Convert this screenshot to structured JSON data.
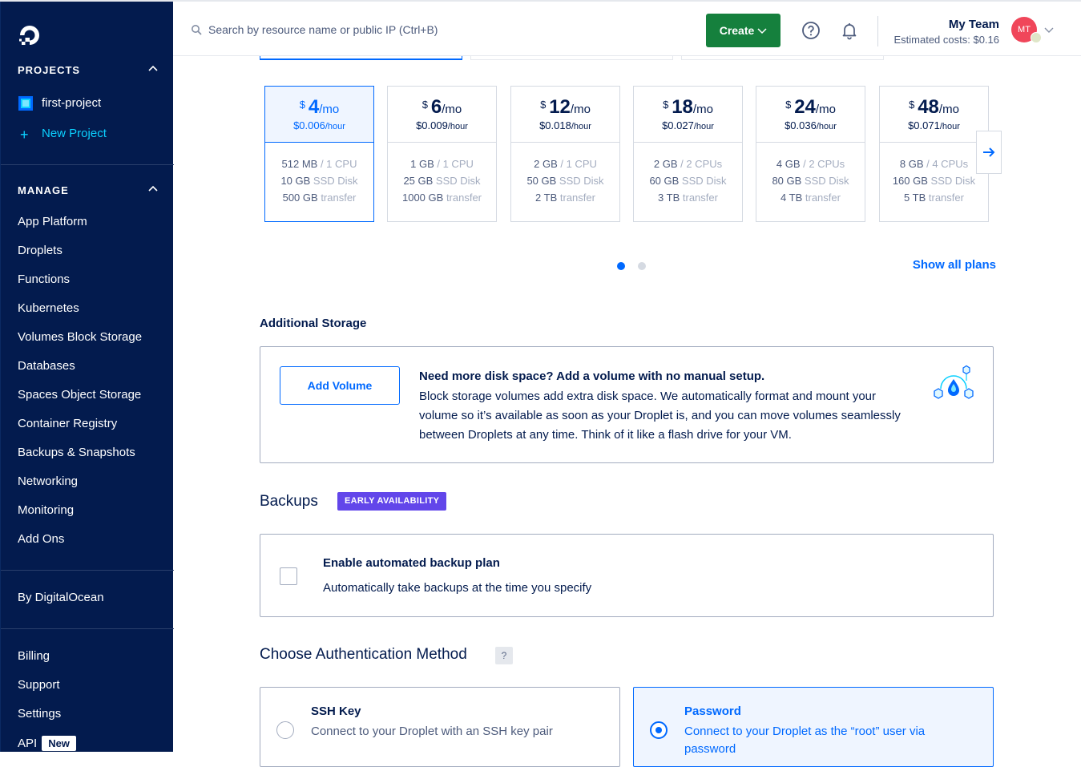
{
  "colors": {
    "sidebar_bg": "#031b4e",
    "primary": "#0069ff",
    "create_green": "#15803d",
    "badge_purple": "#6246ea"
  },
  "sidebar": {
    "projects_heading": "PROJECTS",
    "projects": [
      {
        "label": "first-project"
      }
    ],
    "new_project_label": "New Project",
    "manage_heading": "MANAGE",
    "manage_items": [
      {
        "label": "App Platform"
      },
      {
        "label": "Droplets"
      },
      {
        "label": "Functions"
      },
      {
        "label": "Kubernetes"
      },
      {
        "label": "Volumes Block Storage"
      },
      {
        "label": "Databases"
      },
      {
        "label": "Spaces Object Storage"
      },
      {
        "label": "Container Registry"
      },
      {
        "label": "Backups & Snapshots"
      },
      {
        "label": "Networking"
      },
      {
        "label": "Monitoring"
      },
      {
        "label": "Add Ons"
      }
    ],
    "by_do": "By DigitalOcean",
    "bottom_items": [
      {
        "label": "Billing"
      },
      {
        "label": "Support"
      },
      {
        "label": "Settings"
      }
    ],
    "api_label": "API",
    "api_badge": "New"
  },
  "topbar": {
    "search_placeholder": "Search by resource name or public IP (Ctrl+B)",
    "create_label": "Create",
    "team_name": "My Team",
    "estimated_costs": "Estimated costs: $0.16",
    "avatar_initials": "MT"
  },
  "plans": [
    {
      "currency": "$",
      "price": "4",
      "per": "/mo",
      "hourly": "$0.006",
      "hour_unit": "/hour",
      "mem": "512 MB",
      "cpu": "/ 1 CPU",
      "disk": "10 GB",
      "disk_label": "SSD Disk",
      "transfer": "500 GB",
      "transfer_label": "transfer",
      "selected": true
    },
    {
      "currency": "$",
      "price": "6",
      "per": "/mo",
      "hourly": "$0.009",
      "hour_unit": "/hour",
      "mem": "1 GB",
      "cpu": "/ 1 CPU",
      "disk": "25 GB",
      "disk_label": "SSD Disk",
      "transfer": "1000 GB",
      "transfer_label": "transfer",
      "selected": false
    },
    {
      "currency": "$",
      "price": "12",
      "per": "/mo",
      "hourly": "$0.018",
      "hour_unit": "/hour",
      "mem": "2 GB",
      "cpu": "/ 1 CPU",
      "disk": "50 GB",
      "disk_label": "SSD Disk",
      "transfer": "2 TB",
      "transfer_label": "transfer",
      "selected": false
    },
    {
      "currency": "$",
      "price": "18",
      "per": "/mo",
      "hourly": "$0.027",
      "hour_unit": "/hour",
      "mem": "2 GB",
      "cpu": "/ 2 CPUs",
      "disk": "60 GB",
      "disk_label": "SSD Disk",
      "transfer": "3 TB",
      "transfer_label": "transfer",
      "selected": false
    },
    {
      "currency": "$",
      "price": "24",
      "per": "/mo",
      "hourly": "$0.036",
      "hour_unit": "/hour",
      "mem": "4 GB",
      "cpu": "/ 2 CPUs",
      "disk": "80 GB",
      "disk_label": "SSD Disk",
      "transfer": "4 TB",
      "transfer_label": "transfer",
      "selected": false
    },
    {
      "currency": "$",
      "price": "48",
      "per": "/mo",
      "hourly": "$0.071",
      "hour_unit": "/hour",
      "mem": "8 GB",
      "cpu": "/ 4 CPUs",
      "disk": "160 GB",
      "disk_label": "SSD Disk",
      "transfer": "5 TB",
      "transfer_label": "transfer",
      "selected": false
    }
  ],
  "carousel": {
    "pages": 2,
    "active_page": 1
  },
  "show_all_plans": "Show all plans",
  "storage": {
    "heading": "Additional Storage",
    "button": "Add Volume",
    "title": "Need more disk space? Add a volume with no manual setup.",
    "description": "Block storage volumes add extra disk space. We automatically format and mount your volume so it’s available as soon as your Droplet is, and you can move volumes seamlessly between Droplets at any time. Think of it like a flash drive for your VM."
  },
  "backups": {
    "heading": "Backups",
    "badge": "EARLY AVAILABILITY",
    "title": "Enable automated backup plan",
    "description": "Automatically take backups at the time you specify",
    "checked": false
  },
  "auth": {
    "heading": "Choose Authentication Method",
    "help": "?",
    "options": [
      {
        "title": "SSH Key",
        "description": "Connect to your Droplet with an SSH key pair",
        "selected": false
      },
      {
        "title": "Password",
        "description": "Connect to your Droplet as the “root” user via password",
        "selected": true
      }
    ]
  }
}
